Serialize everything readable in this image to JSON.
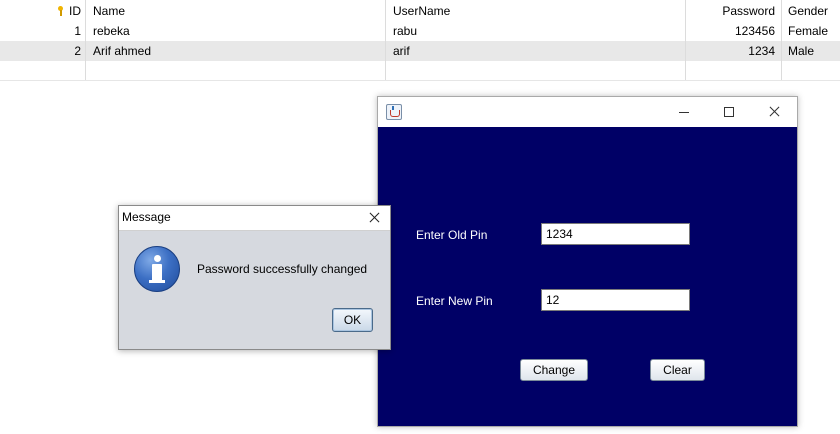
{
  "table": {
    "columns": {
      "id": "ID",
      "name": "Name",
      "username": "UserName",
      "password": "Password",
      "gender": "Gender"
    },
    "rows": [
      {
        "id": "1",
        "name": "rebeka",
        "username": "rabu",
        "password": "123456",
        "gender": "Female"
      },
      {
        "id": "2",
        "name": "Arif ahmed",
        "username": "arif",
        "password": "1234",
        "gender": "Male"
      }
    ]
  },
  "pin_window": {
    "app_icon": "java-icon",
    "old_pin_label": "Enter Old Pin",
    "old_pin_value": "1234",
    "new_pin_label": "Enter New Pin",
    "new_pin_value": "12",
    "change_label": "Change",
    "clear_label": "Clear",
    "background_color": "#000066"
  },
  "message_dialog": {
    "title": "Message",
    "icon": "info-icon",
    "text": "Password successfully changed",
    "ok_label": "OK"
  }
}
